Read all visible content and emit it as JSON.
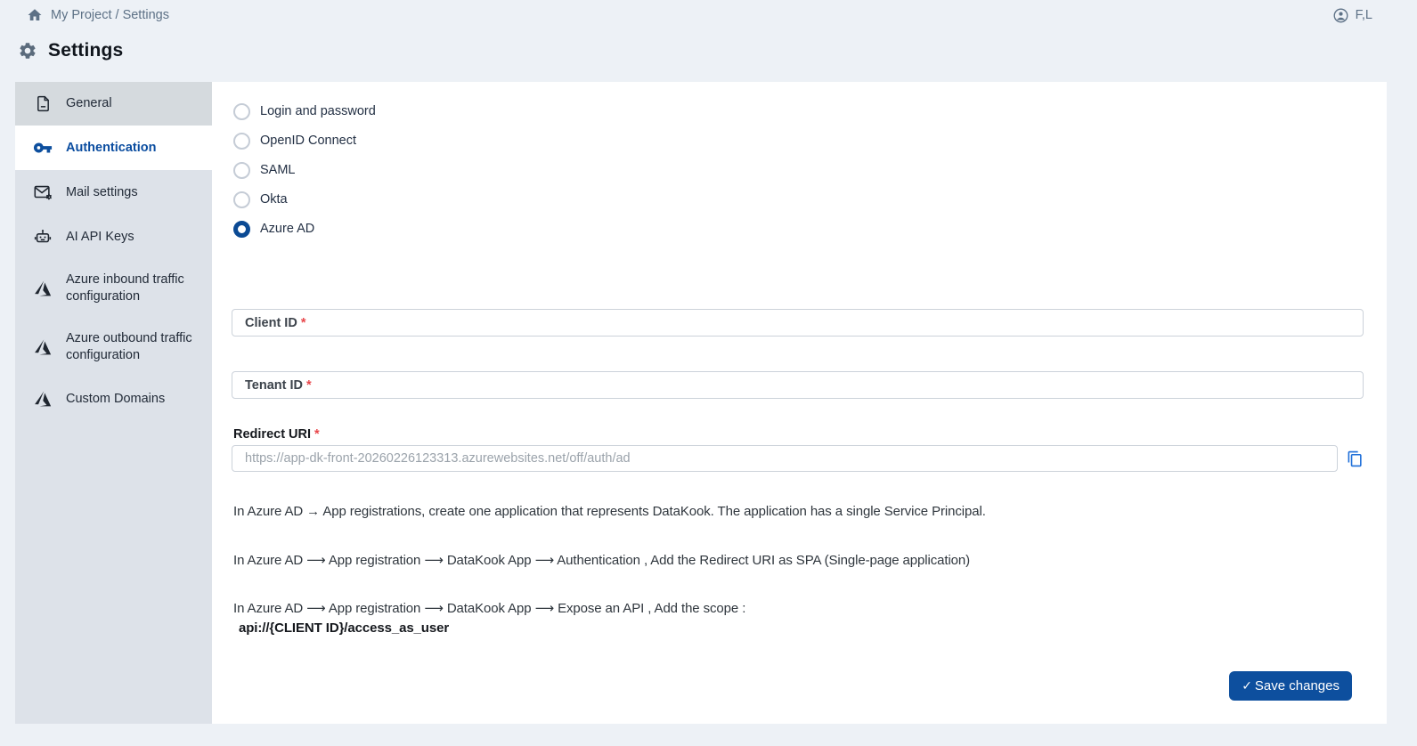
{
  "topbar": {
    "breadcrumb": "My Project / Settings",
    "user_initials": "F,L"
  },
  "page_title": "Settings",
  "sidebar": {
    "items": [
      {
        "label": "General",
        "icon": "document-icon",
        "active": false
      },
      {
        "label": "Authentication",
        "icon": "key-icon",
        "active": true
      },
      {
        "label": "Mail settings",
        "icon": "mail-gear-icon",
        "active": false
      },
      {
        "label": "AI API Keys",
        "icon": "robot-icon",
        "active": false
      },
      {
        "label": "Azure inbound traffic configuration",
        "icon": "azure-icon",
        "active": false
      },
      {
        "label": "Azure outbound traffic configuration",
        "icon": "azure-icon",
        "active": false
      },
      {
        "label": "Custom Domains",
        "icon": "azure-icon",
        "active": false
      }
    ]
  },
  "auth": {
    "required_mark": "*",
    "options": [
      {
        "label": "Login and password",
        "selected": false
      },
      {
        "label": "OpenID Connect",
        "selected": false
      },
      {
        "label": "SAML",
        "selected": false
      },
      {
        "label": "Okta",
        "selected": false
      },
      {
        "label": "Azure AD",
        "selected": true
      }
    ],
    "fields": {
      "client_id": {
        "label": "Client ID",
        "value": ""
      },
      "tenant_id": {
        "label": "Tenant ID",
        "value": ""
      },
      "redirect_uri": {
        "label": "Redirect URI",
        "placeholder": "https://app-dk-front-20260226123313.azurewebsites.net/off/auth/ad"
      }
    },
    "instructions": [
      "In Azure AD → App registrations, create one application that represents DataKook. The application has a single Service Principal.",
      "In Azure AD ⟶ App registration ⟶ DataKook App ⟶ Authentication , Add the Redirect URI as SPA (Single-page application)",
      "In Azure AD ⟶ App registration ⟶ DataKook App ⟶ Expose an API , Add the scope :"
    ],
    "scope_code": "api://{CLIENT ID}/access_as_user",
    "save_button": "Save changes"
  },
  "colors": {
    "page_bg": "#edf1f6",
    "sidebar_bg": "#dde2e9",
    "accent_blue": "#0d4f9e",
    "active_text": "#0b4da0",
    "required_red": "#e8474b"
  }
}
